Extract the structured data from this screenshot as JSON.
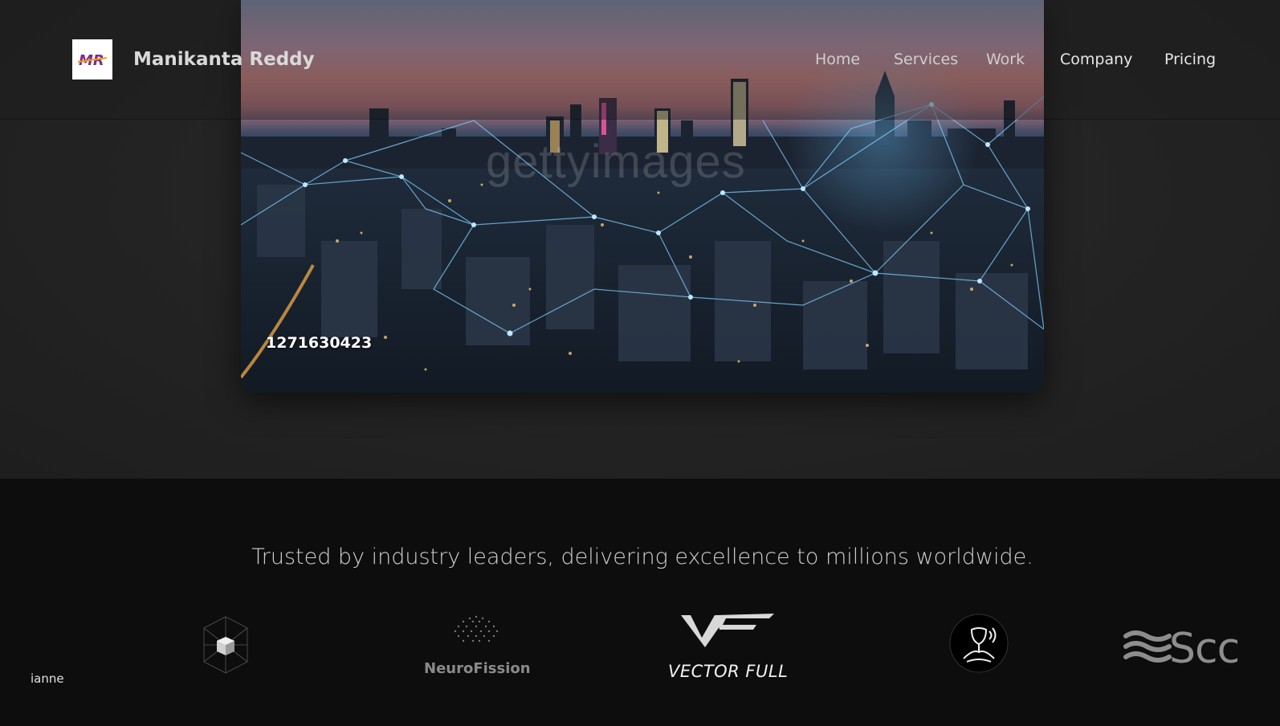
{
  "header": {
    "logo_text": "MR",
    "brand_name": "Manikanta Reddy"
  },
  "nav": {
    "items": [
      {
        "label": "Home"
      },
      {
        "label": "Services"
      },
      {
        "label": "Work"
      },
      {
        "label": "Company"
      },
      {
        "label": "Pricing"
      }
    ]
  },
  "hero": {
    "video_id": "1271630423",
    "watermark": "gettyimages",
    "image_subject": "night city skyline with network lines"
  },
  "trusted": {
    "heading": "Trusted by industry leaders, delivering excellence to millions worldwide.",
    "logos": [
      {
        "name": "partial-logo",
        "label": "ianne"
      },
      {
        "name": "cube-logo",
        "label": ""
      },
      {
        "name": "neurofission-logo",
        "label": "NeuroFission"
      },
      {
        "name": "vector-full-logo",
        "label": "VECTOR FULL"
      },
      {
        "name": "hand-logo",
        "label": ""
      },
      {
        "name": "scc-logo",
        "label": "Scc"
      }
    ]
  },
  "colors": {
    "page_background": "#1b1b1b",
    "trusted_background": "#0d0d0e",
    "logo_accent_purple": "#7b2d8f",
    "logo_accent_orange": "#f5a000"
  }
}
